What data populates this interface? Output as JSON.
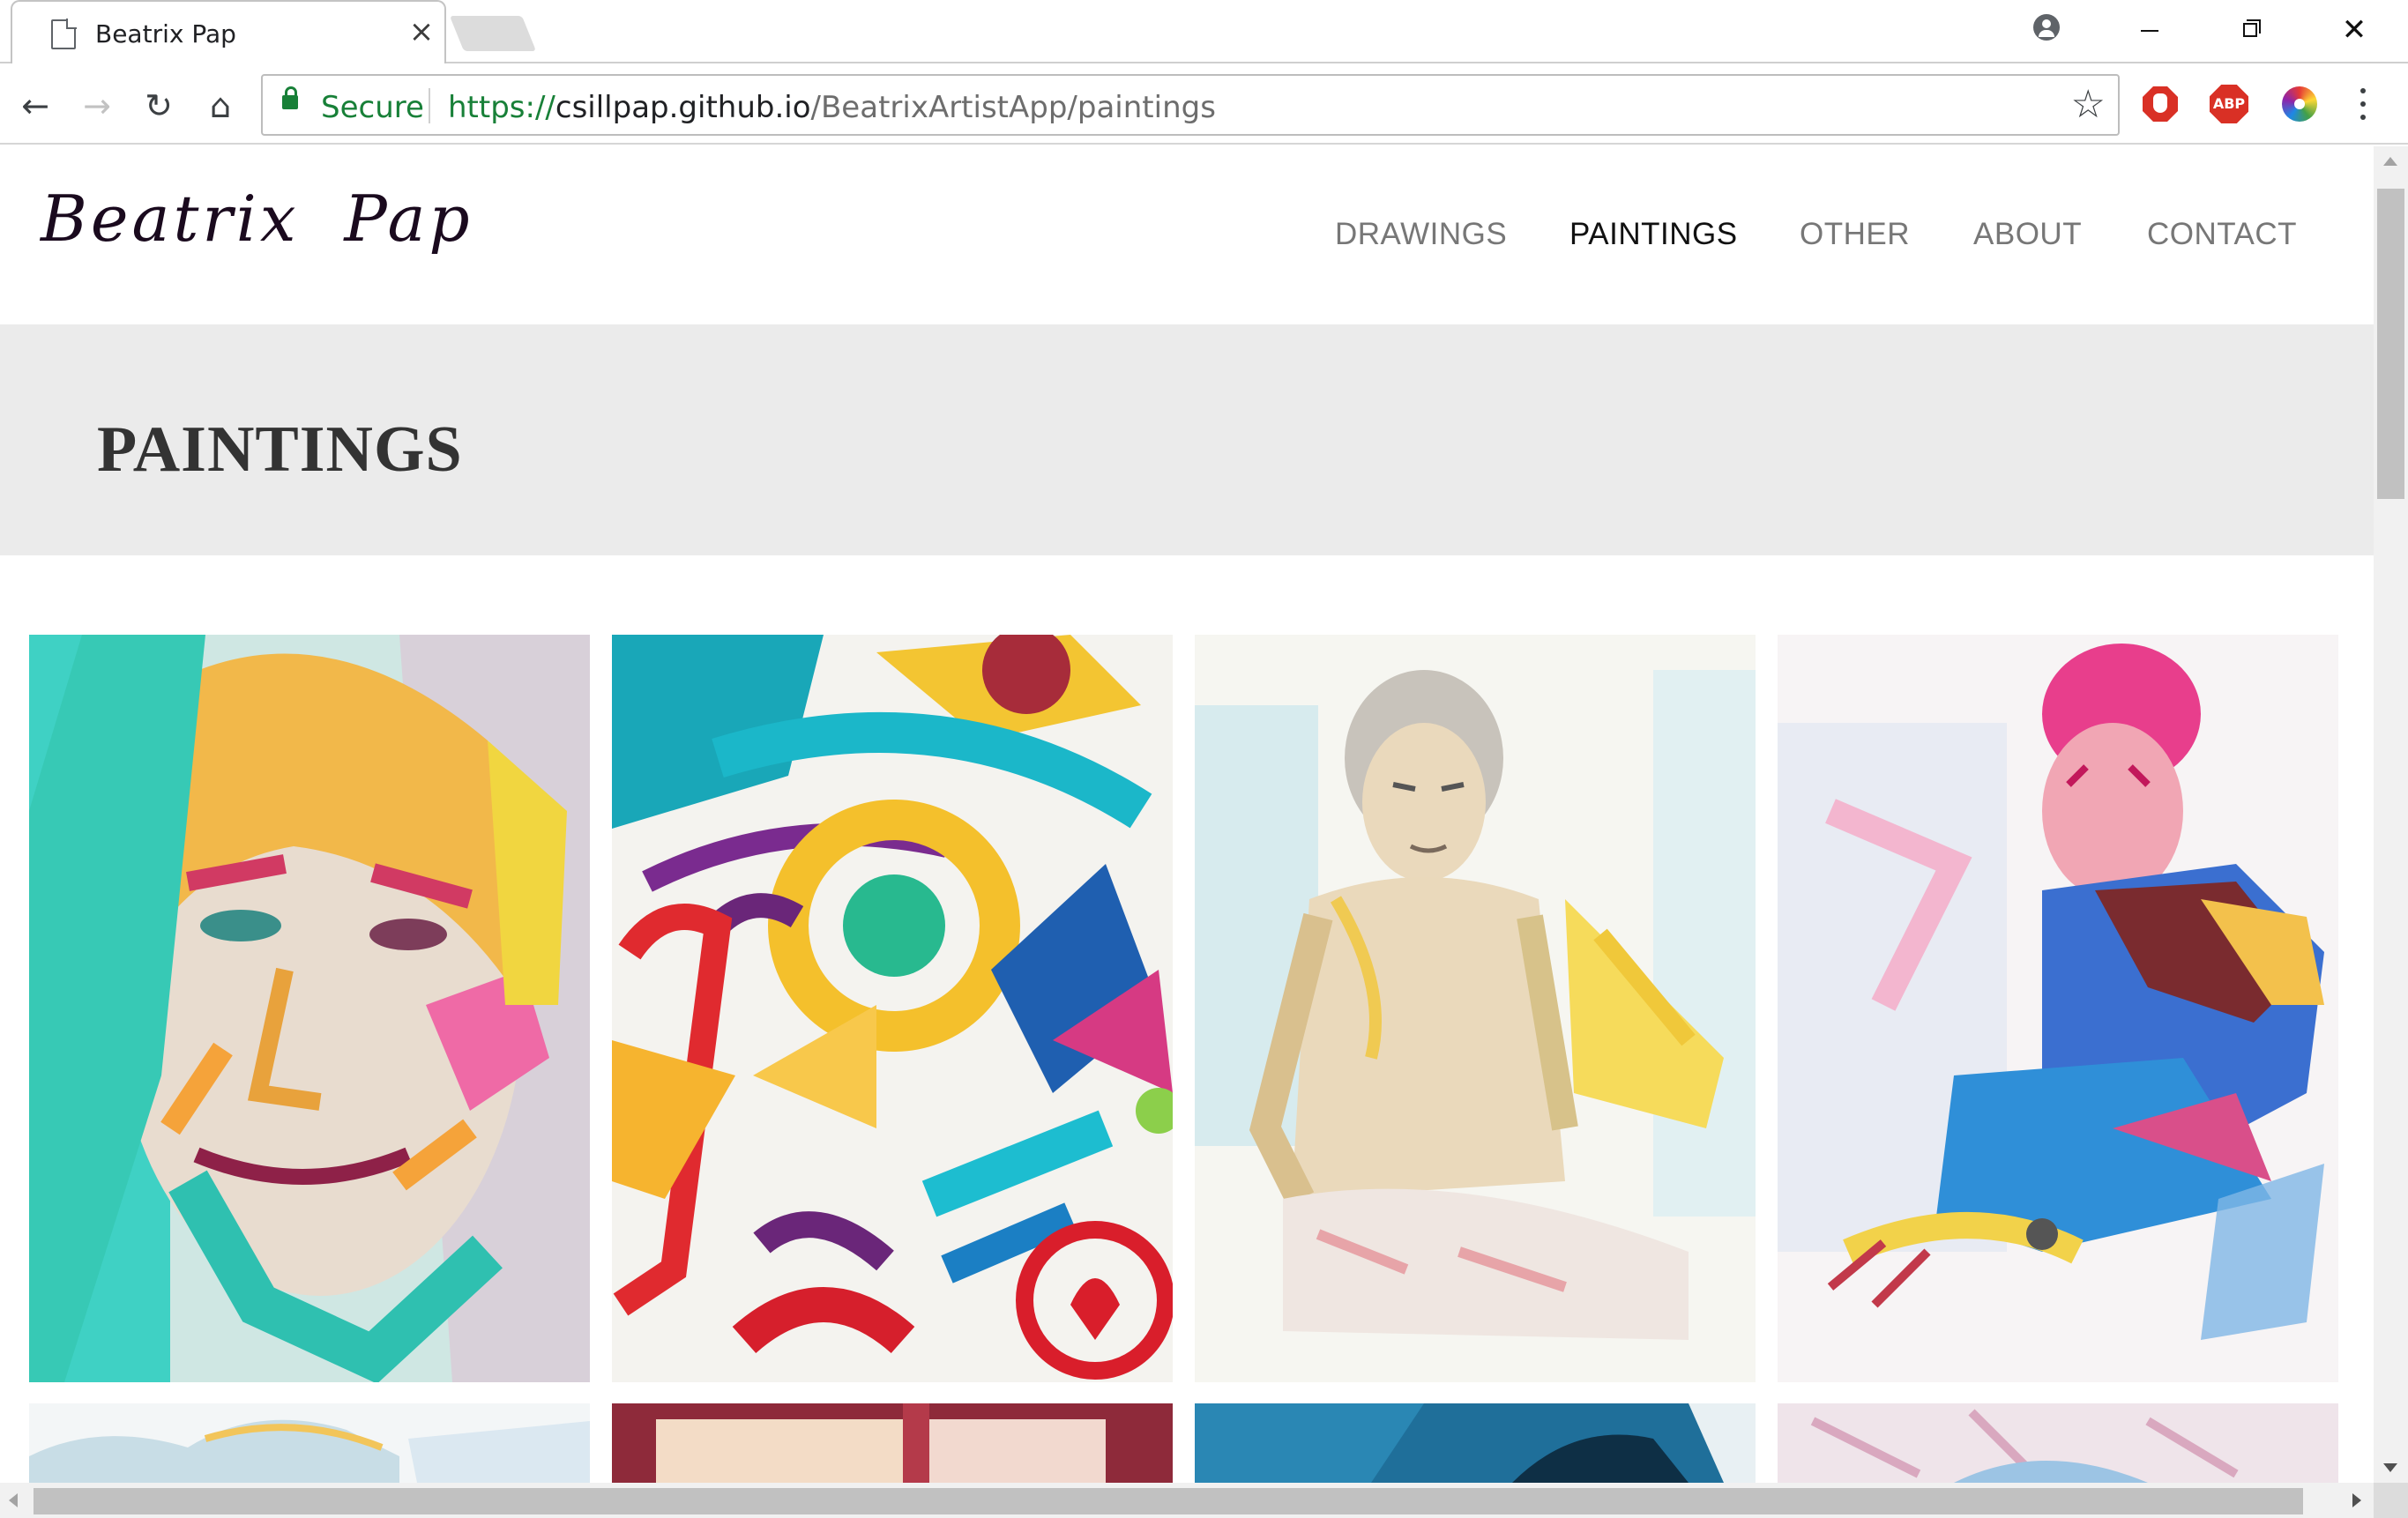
{
  "browser": {
    "tab_title": "Beatrix Pap",
    "tab_close": "×",
    "window_close": "✕",
    "secure_label": "Secure",
    "url_scheme": "https://",
    "url_host": "csillpap.github.io",
    "url_path": "/BeatrixArtistApp/paintings",
    "back": "←",
    "forward": "→",
    "reload": "↻",
    "home": "⌂",
    "star": "☆",
    "abp_label": "ABP",
    "icons": [
      "page-icon",
      "profile-icon",
      "lock-icon",
      "star-icon",
      "adblock-stop-icon",
      "adblock-plus-icon",
      "color-picker-icon",
      "kebab-menu-icon"
    ]
  },
  "site": {
    "logo": "Beatrix Pap",
    "nav": [
      {
        "label": "DRAWINGS",
        "active": false
      },
      {
        "label": "PAINTINGS",
        "active": true
      },
      {
        "label": "OTHER",
        "active": false
      },
      {
        "label": "ABOUT",
        "active": false
      },
      {
        "label": "CONTACT",
        "active": false
      }
    ],
    "page_heading": "PAINTINGS"
  },
  "gallery": {
    "row1": [
      "painting-portrait-woman-turquoise",
      "painting-abstract-face-colorful",
      "painting-seated-old-man-watercolor",
      "painting-seated-woman-pink-hair"
    ],
    "row2": [
      "painting-landscape-pale-blue",
      "painting-interior-window-red",
      "painting-figure-deep-blue",
      "painting-abstract-pastel-pink"
    ]
  }
}
